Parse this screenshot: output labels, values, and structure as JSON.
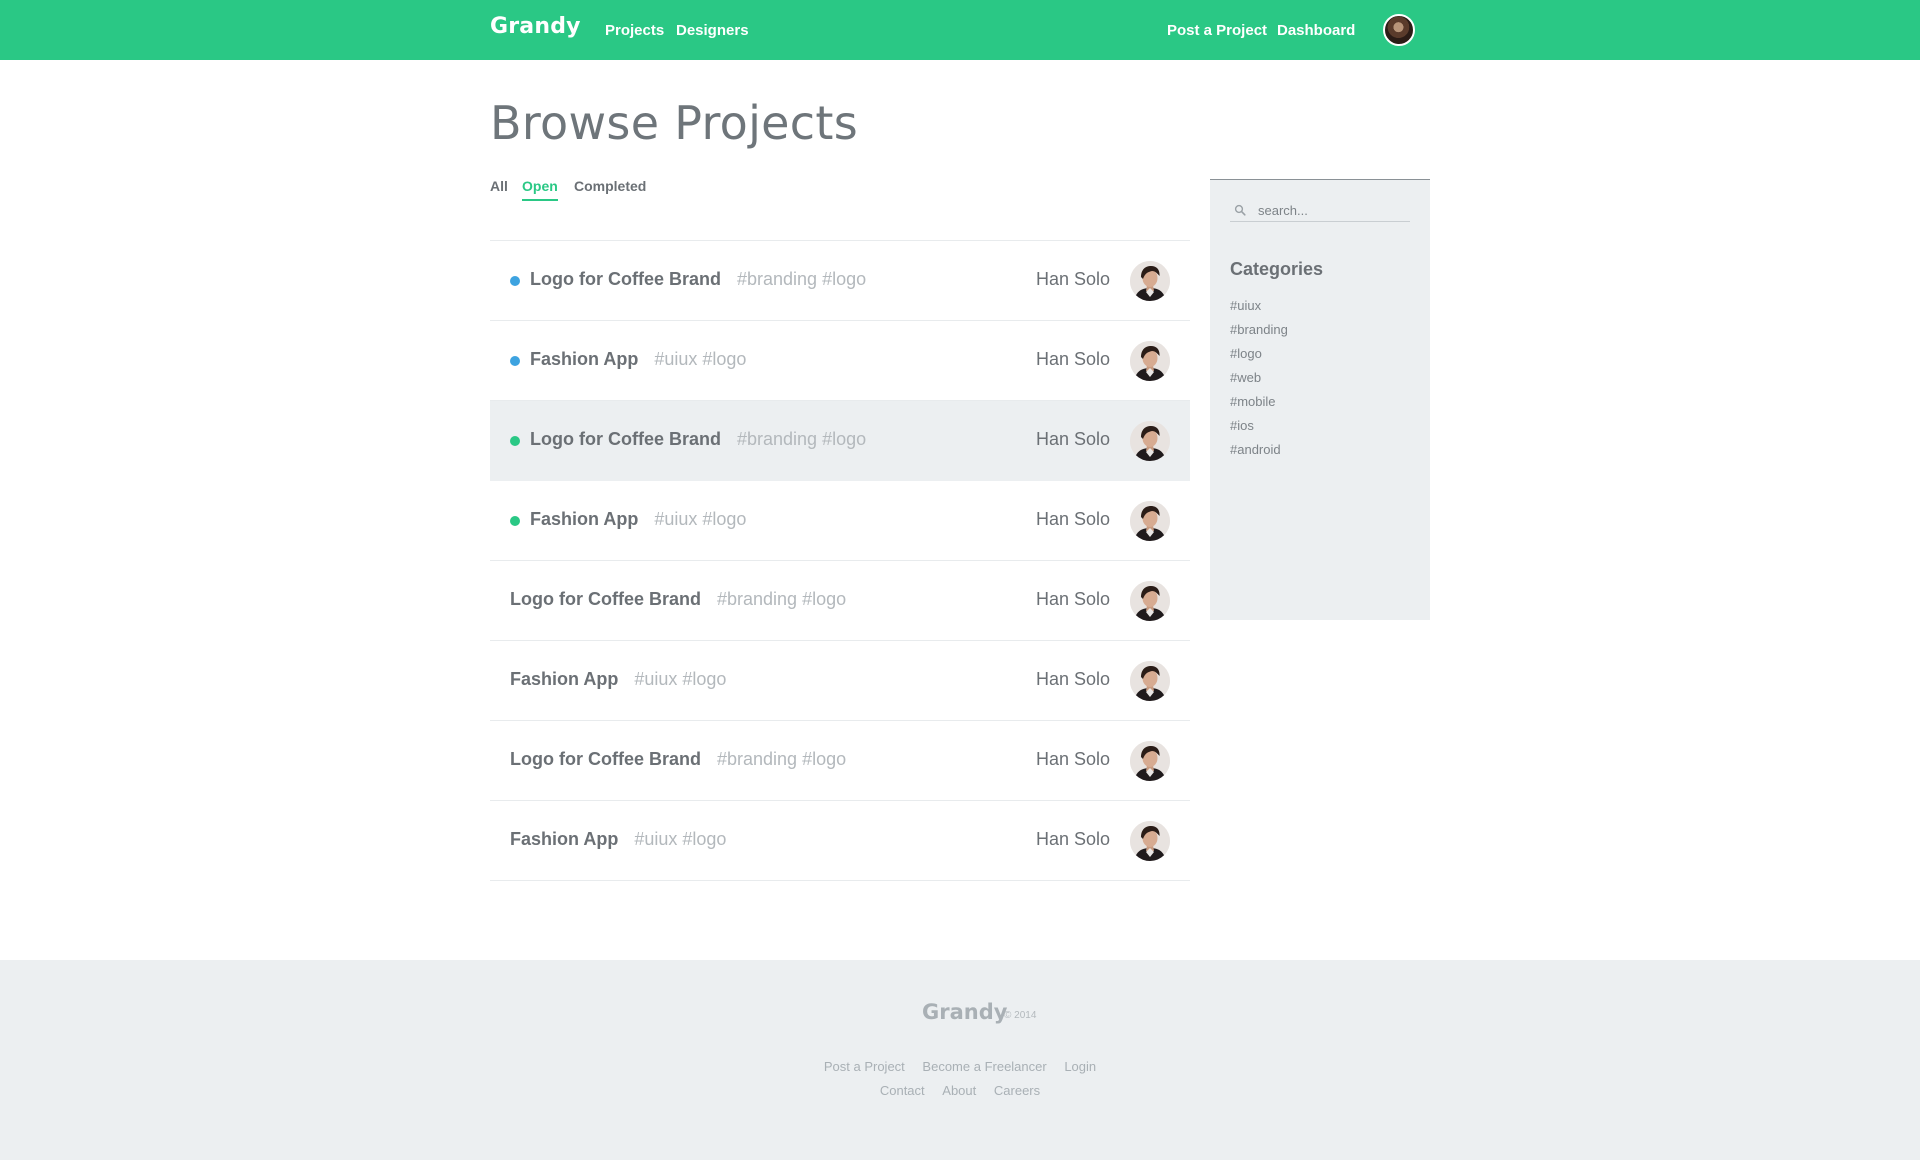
{
  "navbar": {
    "brand": "Grandy",
    "links_left": [
      "Projects",
      "Designers"
    ],
    "links_right": [
      "Post a Project",
      "Dashboard"
    ],
    "bg_color": "#2ac885"
  },
  "page": {
    "title": "Browse Projects",
    "tabs": [
      "All",
      "Open",
      "Completed"
    ],
    "active_tab": "Open"
  },
  "projects": [
    {
      "title": "Logo for Coffee Brand",
      "tags": "#branding #logo",
      "owner": "Han Solo",
      "status": "blue",
      "highlighted": false
    },
    {
      "title": "Fashion App",
      "tags": "#uiux #logo",
      "owner": "Han Solo",
      "status": "blue",
      "highlighted": false
    },
    {
      "title": "Logo for Coffee Brand",
      "tags": "#branding #logo",
      "owner": "Han Solo",
      "status": "green",
      "highlighted": true
    },
    {
      "title": "Fashion App",
      "tags": "#uiux #logo",
      "owner": "Han Solo",
      "status": "green",
      "highlighted": false
    },
    {
      "title": "Logo for Coffee Brand",
      "tags": "#branding #logo",
      "owner": "Han Solo",
      "status": "none",
      "highlighted": false
    },
    {
      "title": "Fashion App",
      "tags": "#uiux #logo",
      "owner": "Han Solo",
      "status": "none",
      "highlighted": false
    },
    {
      "title": "Logo for Coffee Brand",
      "tags": "#branding #logo",
      "owner": "Han Solo",
      "status": "none",
      "highlighted": false
    },
    {
      "title": "Fashion App",
      "tags": "#uiux #logo",
      "owner": "Han Solo",
      "status": "none",
      "highlighted": false
    }
  ],
  "sidebar": {
    "search": {
      "placeholder": "search..."
    },
    "categories_heading": "Categories",
    "categories": [
      "#uiux",
      "#branding",
      "#logo",
      "#web",
      "#mobile",
      "#ios",
      "#android"
    ]
  },
  "footer": {
    "brand": "Grandy",
    "copyright": "© 2014",
    "links_row1": [
      "Post a Project",
      "Become a Freelancer",
      "Login"
    ],
    "links_row2": [
      "Contact",
      "About",
      "Careers"
    ]
  },
  "colors": {
    "accent": "#2ac885",
    "status_blue": "#3da3e0",
    "status_green": "#2ac885",
    "text": "#6b7075",
    "muted": "#b3b8bc",
    "panel": "#eceff1"
  },
  "icons": {
    "search": "search-icon",
    "avatar": "avatar"
  }
}
